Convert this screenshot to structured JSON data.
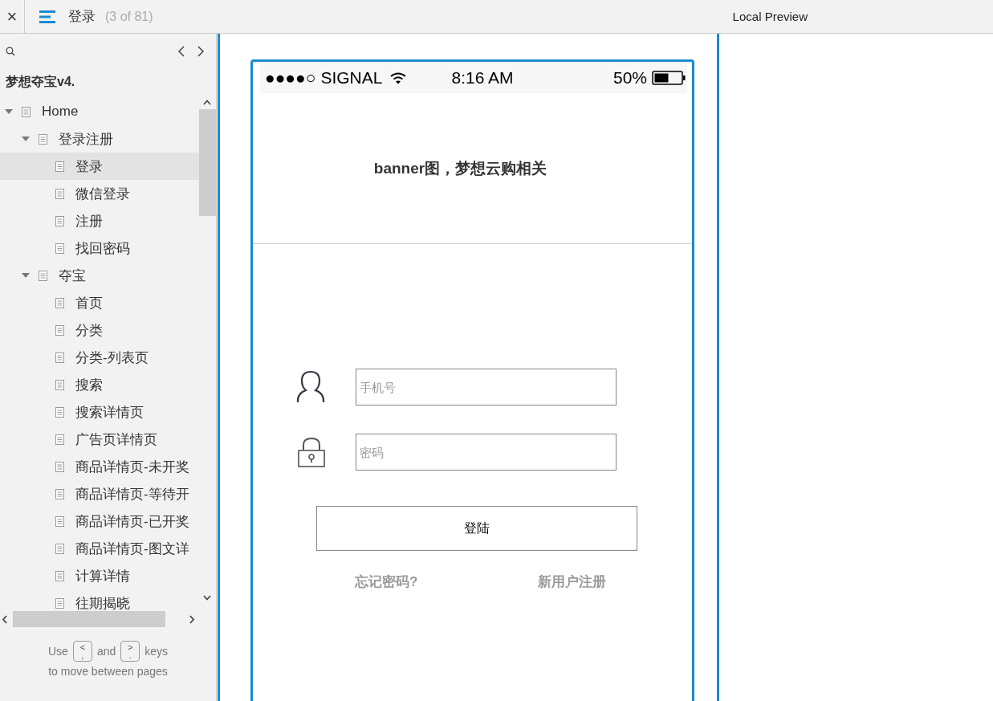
{
  "header": {
    "close": "×",
    "page_title": "登录",
    "page_count": "(3 of 81)",
    "preview_title": "Local Preview"
  },
  "sidebar": {
    "project": "梦想夺宝v4.",
    "tree": [
      {
        "label": "Home",
        "expanded": true,
        "selected": false,
        "children": [
          {
            "label": "登录注册",
            "expanded": true,
            "selected": false,
            "children": [
              {
                "label": "登录",
                "selected": true
              },
              {
                "label": "微信登录",
                "selected": false
              },
              {
                "label": "注册",
                "selected": false
              },
              {
                "label": "找回密码",
                "selected": false
              }
            ]
          },
          {
            "label": "夺宝",
            "expanded": true,
            "selected": false,
            "children": [
              {
                "label": "首页",
                "selected": false
              },
              {
                "label": "分类",
                "selected": false
              },
              {
                "label": "分类-列表页",
                "selected": false
              },
              {
                "label": "搜索",
                "selected": false
              },
              {
                "label": "搜索详情页",
                "selected": false
              },
              {
                "label": "广告页详情页",
                "selected": false
              },
              {
                "label": "商品详情页-未开奖",
                "selected": false
              },
              {
                "label": "商品详情页-等待开",
                "selected": false
              },
              {
                "label": "商品详情页-已开奖",
                "selected": false
              },
              {
                "label": "商品详情页-图文详",
                "selected": false
              },
              {
                "label": "计算详情",
                "selected": false
              },
              {
                "label": "往期揭晓",
                "selected": false
              }
            ]
          }
        ]
      }
    ],
    "hint": {
      "use": "Use",
      "prev_key": [
        "<",
        ","
      ],
      "and": "and",
      "next_key": [
        ">",
        "."
      ],
      "keys": "keys",
      "line2": "to move between pages"
    }
  },
  "phone": {
    "status": {
      "signal": "●●●●○",
      "carrier": "SIGNAL",
      "time": "8:16 AM",
      "battery": "50%"
    },
    "banner": "banner图，梦想云购相关",
    "phone_placeholder": "手机号",
    "password_placeholder": "密码",
    "login_button": "登陆",
    "forgot_link": "忘记密码?",
    "register_link": "新用户注册"
  }
}
